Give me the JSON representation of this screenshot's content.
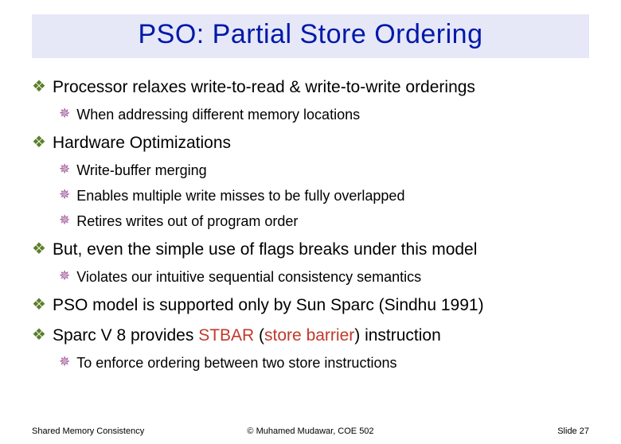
{
  "title": "PSO: Partial Store Ordering",
  "bullets": {
    "b1": "Processor relaxes write-to-read & write-to-write orderings",
    "b1a": "When addressing different memory locations",
    "b2": "Hardware Optimizations",
    "b2a": "Write-buffer merging",
    "b2b": "Enables multiple write misses to be fully overlapped",
    "b2c": "Retires writes out of program order",
    "b3": "But, even the simple use of flags breaks under this model",
    "b3a": "Violates our intuitive sequential consistency semantics",
    "b4": "PSO model is supported only by Sun Sparc (Sindhu 1991)",
    "b5_pre": "Sparc V 8 provides ",
    "b5_hl1": "STBAR",
    "b5_mid": " (",
    "b5_hl2": "store barrier",
    "b5_post": ") instruction",
    "b5a": "To enforce ordering between two store instructions"
  },
  "footer": {
    "left": "Shared Memory Consistency",
    "center": "© Muhamed Mudawar, COE 502",
    "right": "Slide 27"
  }
}
